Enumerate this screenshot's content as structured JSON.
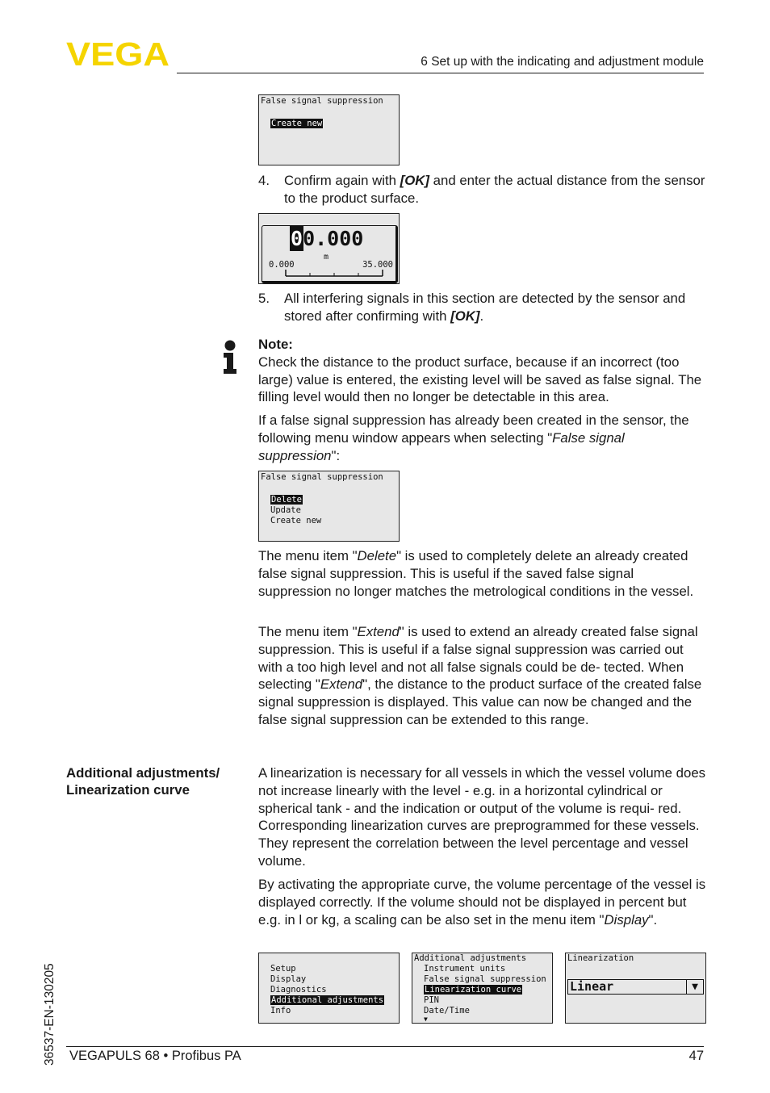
{
  "header": {
    "logo_text": "VEGA",
    "brand_color": "#f5d400",
    "section_title": "6 Set up with the indicating and adjustment module"
  },
  "screens": {
    "fss_create": {
      "title": "False signal suppression",
      "items": [
        {
          "label": "Create new",
          "selected": true
        }
      ]
    },
    "distance": {
      "cursor_digit": "0",
      "value_rest": "0.000",
      "unit": "m",
      "scale_min": "0.000",
      "scale_max": "35.000"
    },
    "fss_menu": {
      "title": "False signal suppression",
      "items": [
        {
          "label": "Delete",
          "selected": true
        },
        {
          "label": "Update",
          "selected": false
        },
        {
          "label": "Create new",
          "selected": false
        }
      ]
    },
    "main_menu": {
      "items": [
        {
          "label": "Setup",
          "selected": false
        },
        {
          "label": "Display",
          "selected": false
        },
        {
          "label": "Diagnostics",
          "selected": false
        },
        {
          "label": "Additional adjustments",
          "selected": true
        },
        {
          "label": "Info",
          "selected": false
        }
      ]
    },
    "additional_menu": {
      "title": "Additional adjustments",
      "items": [
        {
          "label": "Instrument units",
          "selected": false
        },
        {
          "label": "False signal suppression",
          "selected": false
        },
        {
          "label": "Linearization curve",
          "selected": true
        },
        {
          "label": "PIN",
          "selected": false
        },
        {
          "label": "Date/Time",
          "selected": false
        }
      ],
      "more_indicator": "▼"
    },
    "linearization": {
      "title": "Linearization",
      "selected_value": "Linear",
      "dropdown_icon": "▼"
    }
  },
  "steps": {
    "step4": {
      "number": "4.",
      "pre": "Confirm again with ",
      "key": "[OK]",
      "post": " and enter the actual distance from the sensor to the product surface."
    },
    "step5": {
      "number": "5.",
      "pre": "All interfering signals in this section are detected by the sensor and stored after confirming with ",
      "key": "[OK]",
      "post": "."
    }
  },
  "note": {
    "icon": "info-icon",
    "heading": "Note:",
    "text": "Check the distance to the product surface, because if an incorrect (too large) value is entered, the existing level will be saved as false signal. The filling level would then no longer be detectable in this area."
  },
  "paragraphs": {
    "existing_pre": "If a false signal suppression has already been created in the sensor, the following menu window appears when selecting \"",
    "existing_em": "False signal suppression",
    "existing_post": "\":",
    "delete_pre": "The menu item \"",
    "delete_em": "Delete",
    "delete_post": "\" is used to completely delete an already created false signal suppression. This is useful if the saved false signal suppression no longer matches the metrological conditions in the vessel.",
    "extend_pre": "The menu item \"",
    "extend_em": "Extend",
    "extend_mid": "\" is used to extend an already created false signal suppression. This is useful if a false signal suppression was carried out with a too high level and not all false signals could be de- tected. When selecting \"",
    "extend_em2": "Extend",
    "extend_post": "\", the distance to the product surface of the created false signal suppression is displayed. This value can now be changed and the false signal suppression can be extended to this range."
  },
  "linearization_section": {
    "heading_line1": "Additional adjustments/",
    "heading_line2": "Linearization curve",
    "para1": "A linearization is necessary for all vessels in which the vessel volume does not increase linearly with the level - e.g. in a horizontal cylindrical or spherical tank - and the indication or output of the volume is requi- red. Corresponding linearization curves are preprogrammed for these vessels. They represent the correlation between the level percentage and vessel volume.",
    "para2_pre": "By activating the appropriate curve, the volume percentage of the vessel is displayed correctly. If the volume should not be displayed in percent but e.g. in l or kg, a scaling can be also set in the menu item \"",
    "para2_em": "Display",
    "para2_post": "\"."
  },
  "footer": {
    "product": "VEGAPULS 68 • Profibus PA",
    "page_number": "47",
    "doc_code": "36537-EN-130205"
  }
}
